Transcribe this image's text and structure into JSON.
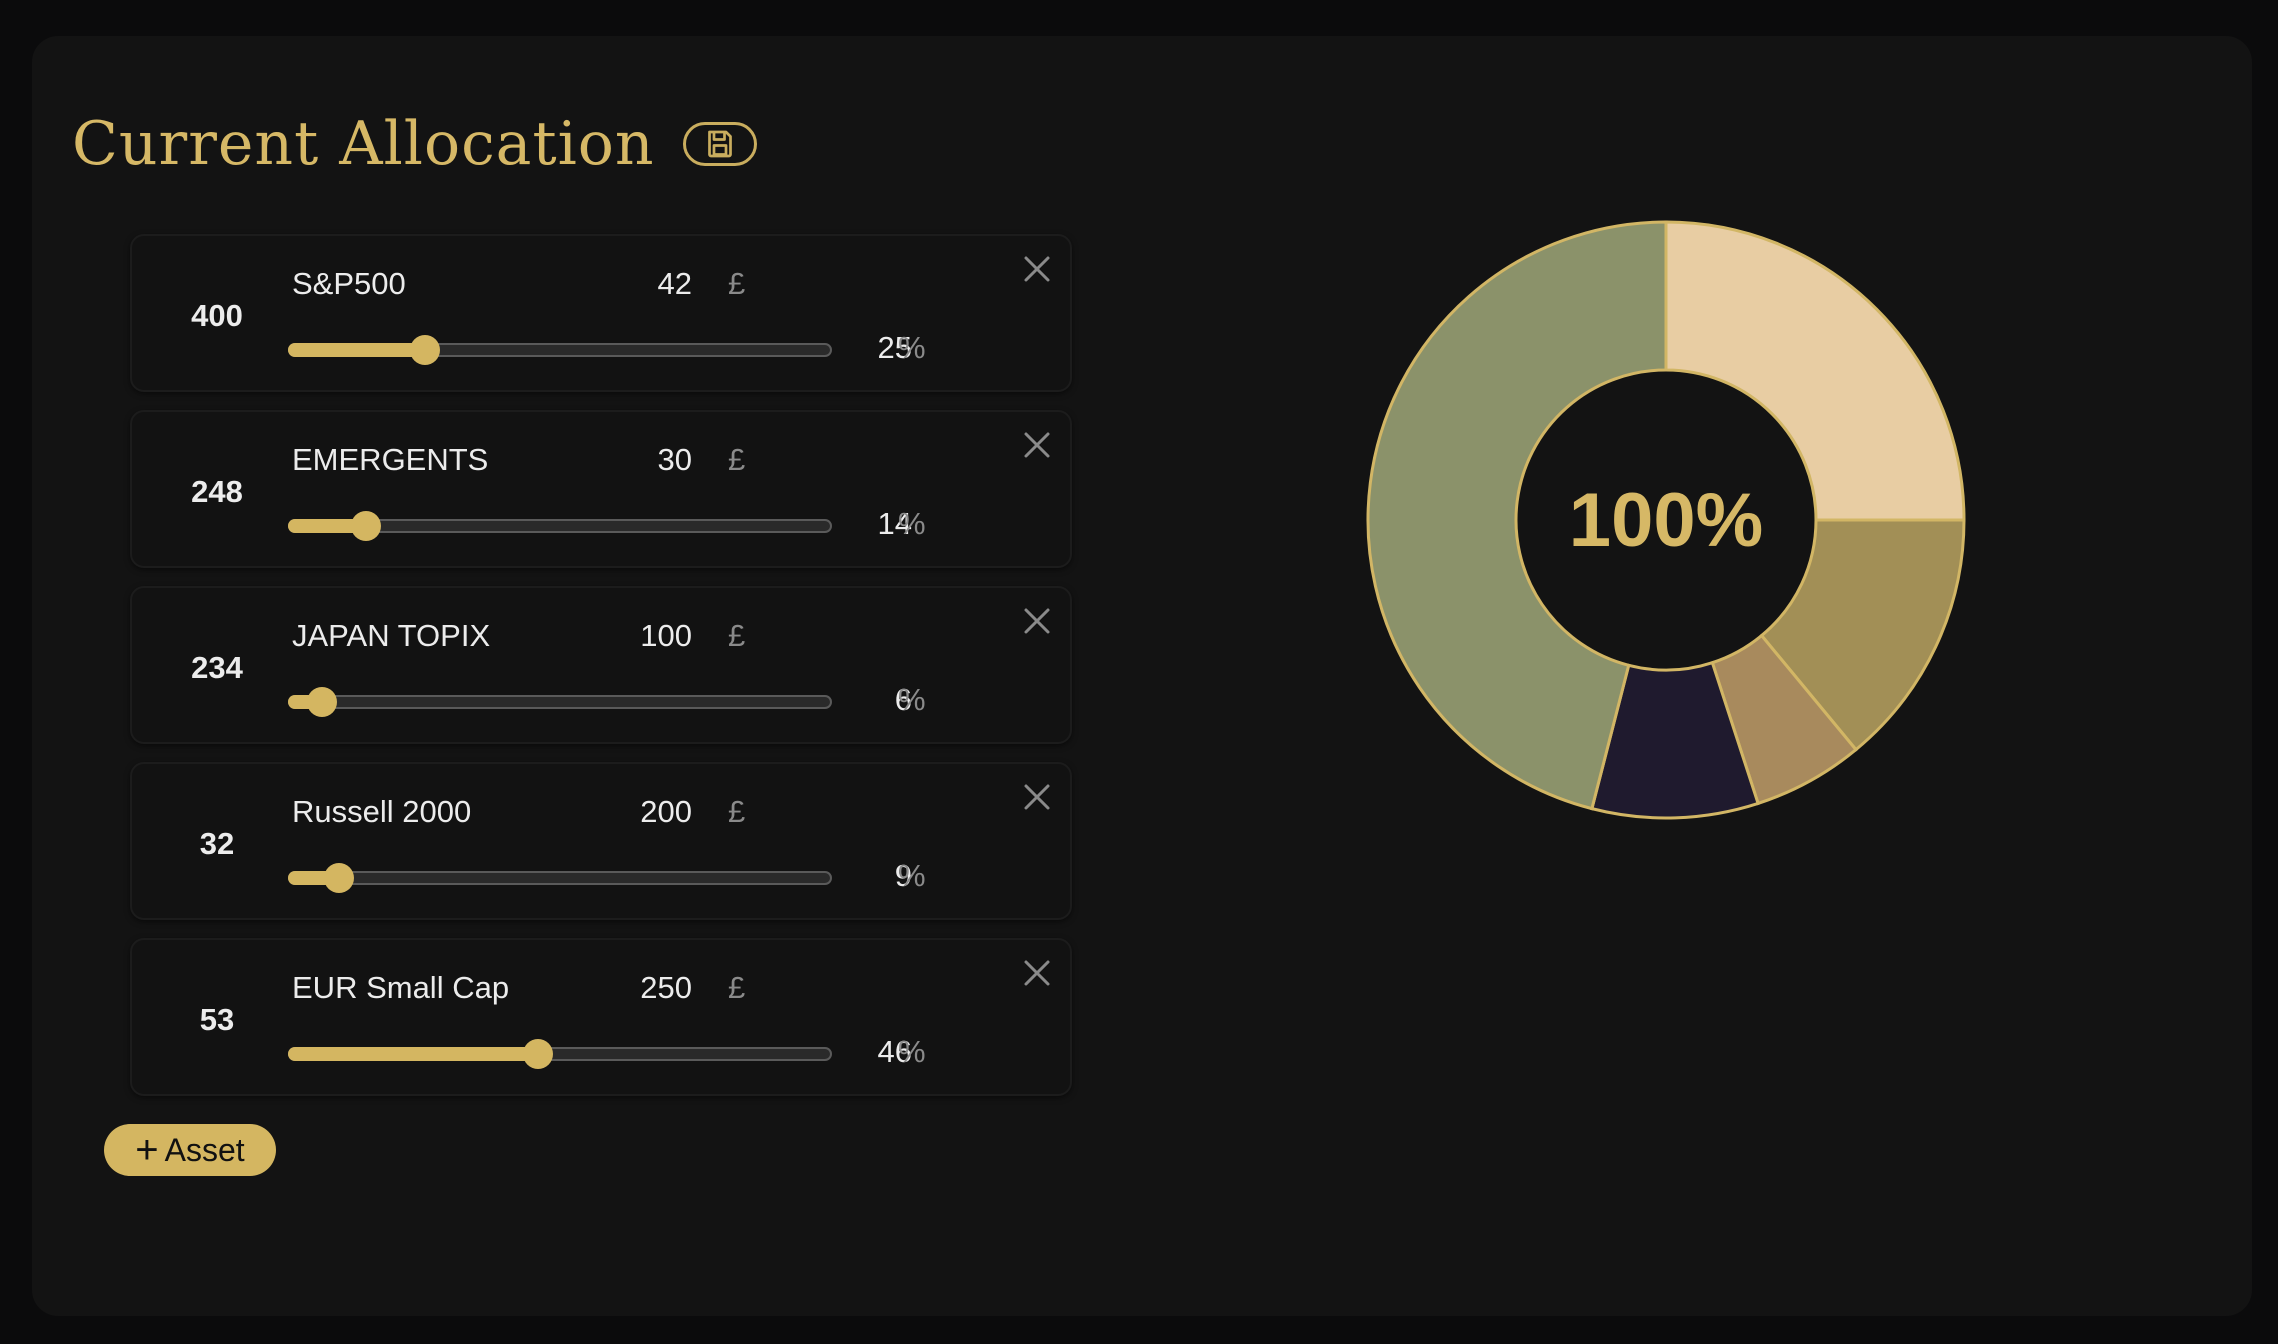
{
  "title": "Current Allocation",
  "currency_symbol": "£",
  "percent_symbol": "%",
  "add_button_label": "Asset",
  "assets": [
    {
      "quantity": "400",
      "name": "S&P500",
      "price": "42",
      "percent": "25"
    },
    {
      "quantity": "248",
      "name": "EMERGENTS",
      "price": "30",
      "percent": "14"
    },
    {
      "quantity": "234",
      "name": "JAPAN TOPIX",
      "price": "100",
      "percent": "6"
    },
    {
      "quantity": "32",
      "name": "Russell 2000",
      "price": "200",
      "percent": "9"
    },
    {
      "quantity": "53",
      "name": "EUR Small Cap",
      "price": "250",
      "percent": "46"
    }
  ],
  "slider_fraction": [
    0.25,
    0.14,
    0.06,
    0.09,
    0.46
  ],
  "donut": {
    "center_label": "100%",
    "colors": {
      "accent": "#d4b661",
      "outline": "#d2b665"
    },
    "segments": [
      {
        "value": 25,
        "color": "#e8cda3"
      },
      {
        "value": 14,
        "color": "#a28f56"
      },
      {
        "value": 6,
        "color": "#a88a5d"
      },
      {
        "value": 9,
        "color": "#1f1a2e"
      },
      {
        "value": 46,
        "color": "#8b926a"
      }
    ]
  }
}
